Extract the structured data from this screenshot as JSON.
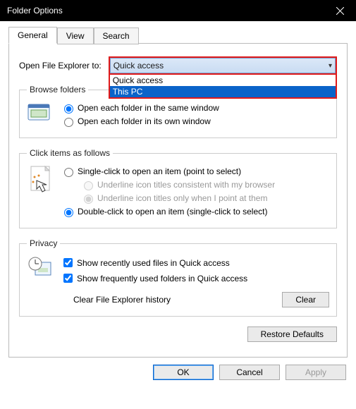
{
  "window": {
    "title": "Folder Options"
  },
  "tabs": {
    "general": "General",
    "view": "View",
    "search": "Search"
  },
  "open": {
    "label": "Open File Explorer to:",
    "selected": "Quick access",
    "options": [
      "Quick access",
      "This PC"
    ]
  },
  "browse": {
    "legend": "Browse folders",
    "same": "Open each folder in the same window",
    "own": "Open each folder in its own window"
  },
  "click": {
    "legend": "Click items as follows",
    "single": "Single-click to open an item (point to select)",
    "ul_browser": "Underline icon titles consistent with my browser",
    "ul_point": "Underline icon titles only when I point at them",
    "double": "Double-click to open an item (single-click to select)"
  },
  "privacy": {
    "legend": "Privacy",
    "recent": "Show recently used files in Quick access",
    "frequent": "Show frequently used folders in Quick access",
    "clear_label": "Clear File Explorer history",
    "clear_btn": "Clear"
  },
  "restore": "Restore Defaults",
  "footer": {
    "ok": "OK",
    "cancel": "Cancel",
    "apply": "Apply"
  }
}
